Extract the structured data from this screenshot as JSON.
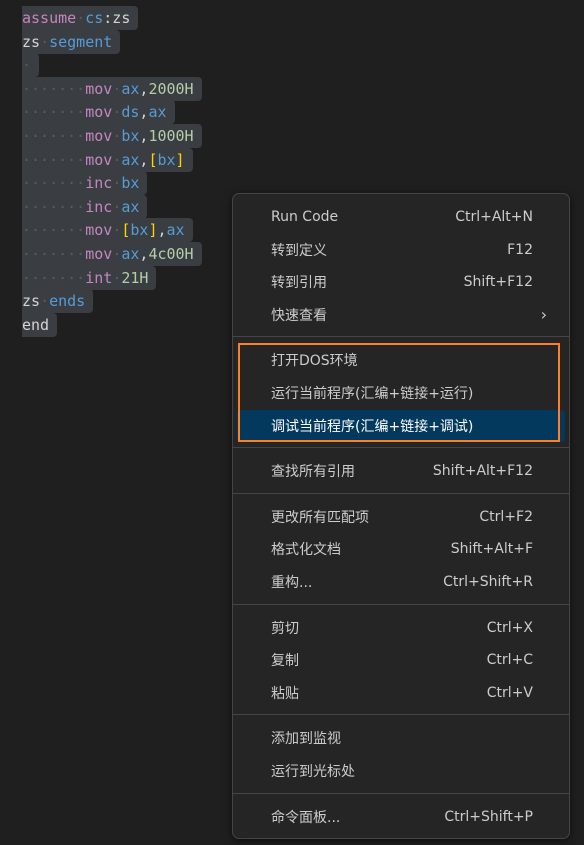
{
  "editor": {
    "lines": [
      {
        "indent": "",
        "tokens": [
          {
            "t": "assume",
            "c": "kw"
          },
          {
            "t": "·",
            "c": "ws"
          },
          {
            "t": "cs",
            "c": "reg"
          },
          {
            "t": ":zs",
            "c": "plain"
          }
        ]
      },
      {
        "indent": "",
        "tokens": [
          {
            "t": "zs",
            "c": "plain"
          },
          {
            "t": "·",
            "c": "ws"
          },
          {
            "t": "segment",
            "c": "reg"
          }
        ]
      },
      {
        "indent": "·",
        "tokens": []
      },
      {
        "indent": "·······",
        "tokens": [
          {
            "t": "mov",
            "c": "kw"
          },
          {
            "t": "·",
            "c": "ws"
          },
          {
            "t": "ax",
            "c": "reg"
          },
          {
            "t": ",",
            "c": "plain"
          },
          {
            "t": "2000H",
            "c": "num"
          }
        ]
      },
      {
        "indent": "·······",
        "tokens": [
          {
            "t": "mov",
            "c": "kw"
          },
          {
            "t": "·",
            "c": "ws"
          },
          {
            "t": "ds",
            "c": "reg"
          },
          {
            "t": ",",
            "c": "plain"
          },
          {
            "t": "ax",
            "c": "reg"
          }
        ]
      },
      {
        "indent": "·······",
        "tokens": [
          {
            "t": "mov",
            "c": "kw"
          },
          {
            "t": "·",
            "c": "ws"
          },
          {
            "t": "bx",
            "c": "reg"
          },
          {
            "t": ",",
            "c": "plain"
          },
          {
            "t": "1000H",
            "c": "num"
          }
        ]
      },
      {
        "indent": "·······",
        "tokens": [
          {
            "t": "mov",
            "c": "kw"
          },
          {
            "t": "·",
            "c": "ws"
          },
          {
            "t": "ax",
            "c": "reg"
          },
          {
            "t": ",",
            "c": "plain"
          },
          {
            "t": "[",
            "c": "brk"
          },
          {
            "t": "bx",
            "c": "reg"
          },
          {
            "t": "]",
            "c": "brk"
          }
        ]
      },
      {
        "indent": "·······",
        "tokens": [
          {
            "t": "inc",
            "c": "kw"
          },
          {
            "t": "·",
            "c": "ws"
          },
          {
            "t": "bx",
            "c": "reg"
          }
        ]
      },
      {
        "indent": "·······",
        "tokens": [
          {
            "t": "inc",
            "c": "kw"
          },
          {
            "t": "·",
            "c": "ws"
          },
          {
            "t": "ax",
            "c": "reg"
          }
        ]
      },
      {
        "indent": "·······",
        "tokens": [
          {
            "t": "mov",
            "c": "kw"
          },
          {
            "t": "·",
            "c": "ws"
          },
          {
            "t": "[",
            "c": "brk"
          },
          {
            "t": "bx",
            "c": "reg"
          },
          {
            "t": "]",
            "c": "brk"
          },
          {
            "t": ",",
            "c": "plain"
          },
          {
            "t": "ax",
            "c": "reg"
          }
        ]
      },
      {
        "indent": "·······",
        "tokens": [
          {
            "t": "mov",
            "c": "kw"
          },
          {
            "t": "·",
            "c": "ws"
          },
          {
            "t": "ax",
            "c": "reg"
          },
          {
            "t": ",",
            "c": "plain"
          },
          {
            "t": "4c00H",
            "c": "num"
          }
        ]
      },
      {
        "indent": "·······",
        "tokens": [
          {
            "t": "int",
            "c": "kw"
          },
          {
            "t": "·",
            "c": "ws"
          },
          {
            "t": "21H",
            "c": "num"
          }
        ]
      },
      {
        "indent": "",
        "tokens": [
          {
            "t": "zs",
            "c": "plain"
          },
          {
            "t": "·",
            "c": "ws"
          },
          {
            "t": "ends",
            "c": "reg"
          }
        ]
      },
      {
        "indent": "",
        "tokens": [
          {
            "t": "end",
            "c": "plain"
          }
        ]
      }
    ]
  },
  "context_menu": {
    "groups": [
      [
        {
          "label": "Run Code",
          "shortcut": "Ctrl+Alt+N"
        },
        {
          "label": "转到定义",
          "shortcut": "F12"
        },
        {
          "label": "转到引用",
          "shortcut": "Shift+F12"
        },
        {
          "label": "快速查看",
          "shortcut": "",
          "submenu": true
        }
      ],
      [
        {
          "label": "打开DOS环境",
          "shortcut": ""
        },
        {
          "label": "运行当前程序(汇编+链接+运行)",
          "shortcut": ""
        },
        {
          "label": "调试当前程序(汇编+链接+调试)",
          "shortcut": "",
          "active": true
        }
      ],
      [
        {
          "label": "查找所有引用",
          "shortcut": "Shift+Alt+F12"
        }
      ],
      [
        {
          "label": "更改所有匹配项",
          "shortcut": "Ctrl+F2"
        },
        {
          "label": "格式化文档",
          "shortcut": "Shift+Alt+F"
        },
        {
          "label": "重构...",
          "shortcut": "Ctrl+Shift+R"
        }
      ],
      [
        {
          "label": "剪切",
          "shortcut": "Ctrl+X"
        },
        {
          "label": "复制",
          "shortcut": "Ctrl+C"
        },
        {
          "label": "粘贴",
          "shortcut": "Ctrl+V"
        }
      ],
      [
        {
          "label": "添加到监视",
          "shortcut": ""
        },
        {
          "label": "运行到光标处",
          "shortcut": ""
        }
      ],
      [
        {
          "label": "命令面板...",
          "shortcut": "Ctrl+Shift+P"
        }
      ]
    ],
    "submenu_icon": "chevron-right-icon",
    "highlight_color": "#ff7f27",
    "active_bg": "#04395e"
  }
}
